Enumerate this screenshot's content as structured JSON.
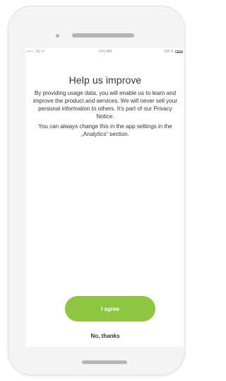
{
  "statusbar": {
    "signal": "•••○○ 3G ᯤ",
    "time": "9:41 AM",
    "battery": "100 %"
  },
  "content": {
    "title": "Help us improve",
    "paragraph1": "By providing usage data, you will enable us to learn and improve the product and services. We will never sell your personal information to others. It’s part of our Privacy Notice.",
    "paragraph2": "You can always change this in the app settings in the „Analytics“ section."
  },
  "actions": {
    "agree_label": "I agree",
    "decline_label": "No, thanks"
  },
  "colors": {
    "accent": "#8dc63f",
    "text": "#333333",
    "device": "#f4f4f4"
  },
  "icons": [
    "signal-icon",
    "wifi-icon",
    "battery-icon"
  ]
}
